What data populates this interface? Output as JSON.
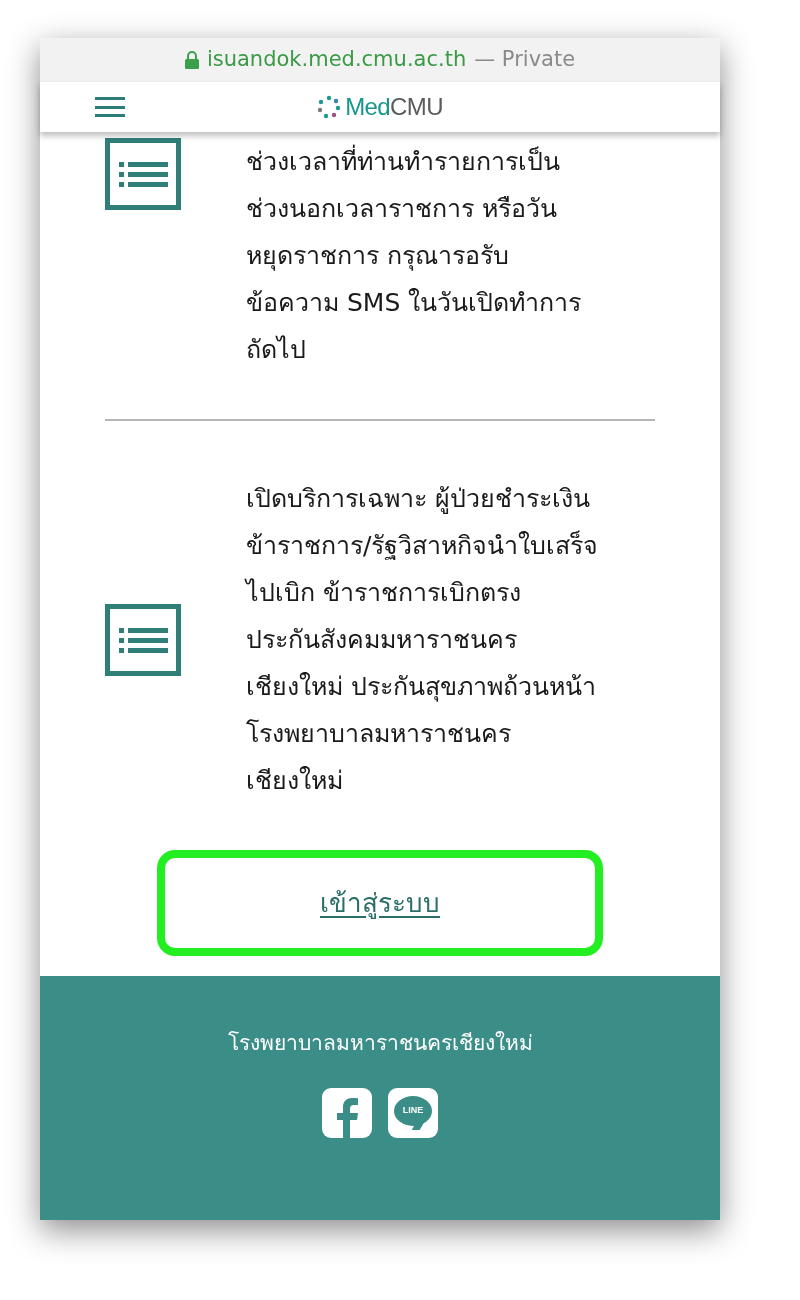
{
  "browser": {
    "domain": "isuandok.med.cmu.ac.th",
    "suffix": "— Private"
  },
  "header": {
    "logo": [
      {
        "text": "Med",
        "color": "#17968c"
      },
      {
        "text": "CMU",
        "color": "#5b5b5b"
      }
    ]
  },
  "items": [
    {
      "lines": [
        "ช่วงเวลาที่ท่านทำรายการเป็น",
        "ช่วงนอกเวลาราชการ หรือวัน",
        "หยุดราชการ กรุณารอรับ",
        "ข้อความ SMS ในวันเปิดทำการ",
        "ถัดไป"
      ],
      "kind": "top"
    },
    {
      "lines": [
        "เปิดบริการเฉพาะ ผู้ป่วยชำระเงิน",
        "ข้าราชการ/รัฐวิสาหกิจนำใบเสร็จ",
        "ไปเบิก ข้าราชการเบิกตรง",
        "ประกันสังคมมหาราชนคร",
        "เชียงใหม่ ประกันสุขภาพถ้วนหน้า",
        "โรงพยาบาลมหาราชนคร",
        "เชียงใหม่"
      ],
      "kind": "middle"
    }
  ],
  "login_button": {
    "label": "เข้าสู่ระบบ",
    "highlighted": true
  },
  "footer": {
    "title": "โรงพยาบาลมหาราชนครเชียงใหม่",
    "socials": [
      {
        "kind": "facebook"
      },
      {
        "kind": "line",
        "label": "LINE"
      }
    ]
  }
}
